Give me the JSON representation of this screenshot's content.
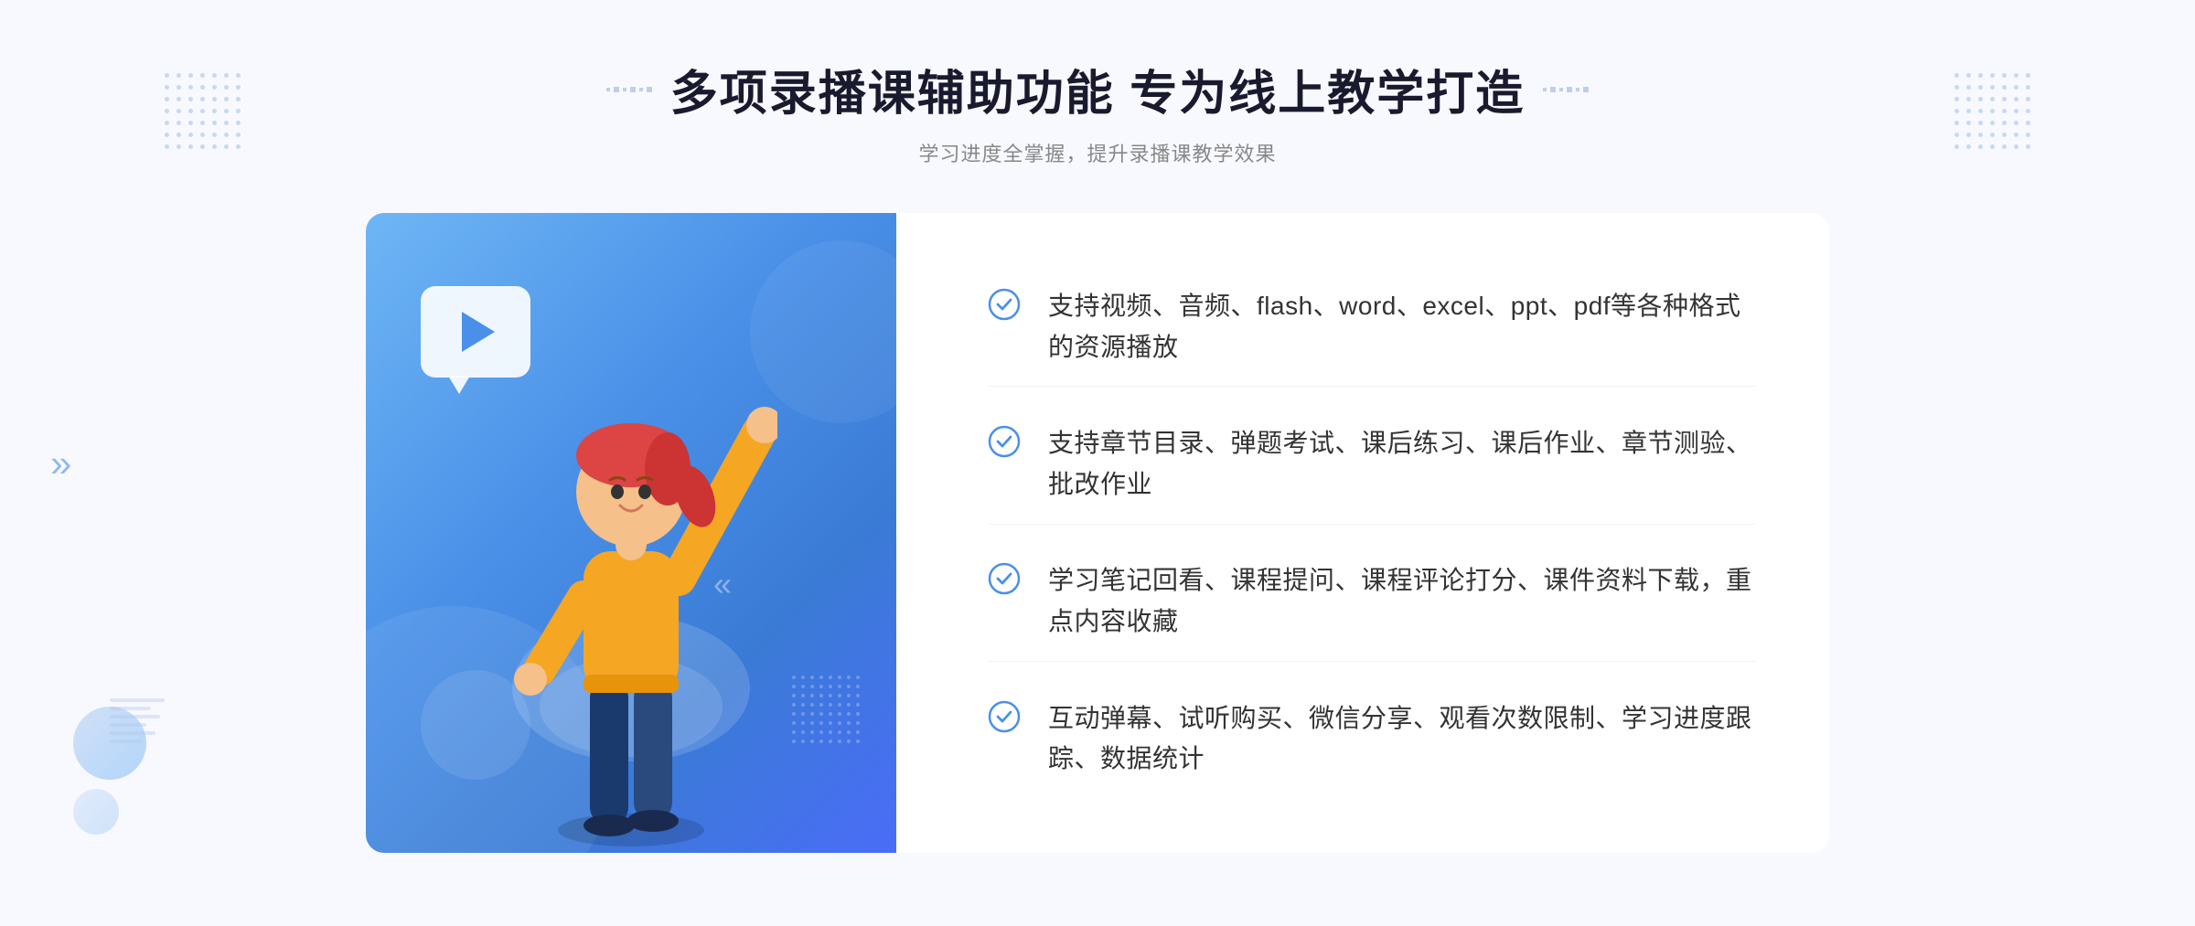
{
  "header": {
    "title": "多项录播课辅助功能 专为线上教学打造",
    "subtitle": "学习进度全掌握，提升录播课教学效果",
    "decorator_left": "❖",
    "decorator_right": "❖"
  },
  "features": [
    {
      "id": "feature-1",
      "text": "支持视频、音频、flash、word、excel、ppt、pdf等各种格式的资源播放"
    },
    {
      "id": "feature-2",
      "text": "支持章节目录、弹题考试、课后练习、课后作业、章节测验、批改作业"
    },
    {
      "id": "feature-3",
      "text": "学习笔记回看、课程提问、课程评论打分、课件资料下载，重点内容收藏"
    },
    {
      "id": "feature-4",
      "text": "互动弹幕、试听购买、微信分享、观看次数限制、学习进度跟踪、数据统计"
    }
  ],
  "colors": {
    "primary_blue": "#4a90e8",
    "light_blue": "#6eb6f5",
    "dark_blue": "#3a7bd5",
    "text_dark": "#1a1a2e",
    "text_gray": "#888888",
    "text_feature": "#333333",
    "bg_light": "#f8f9ff",
    "check_color": "#4a90e8"
  },
  "illustration": {
    "play_label": "▶"
  }
}
